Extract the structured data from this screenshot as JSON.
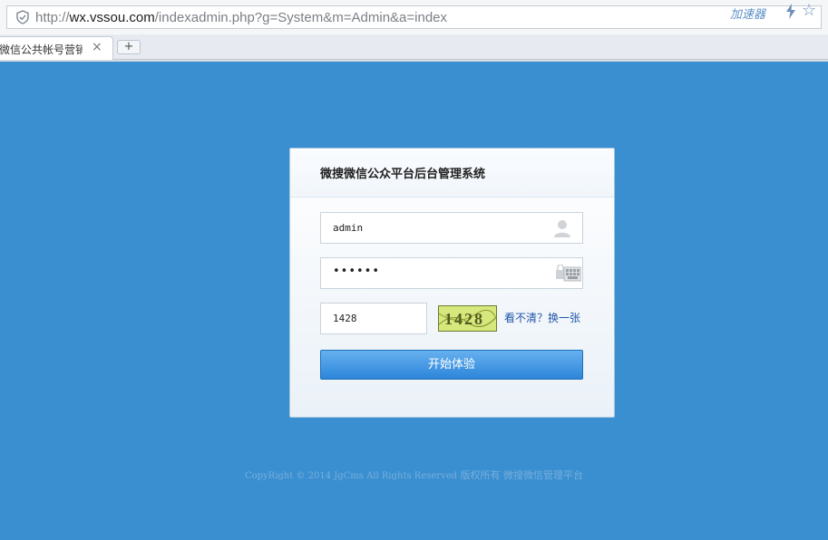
{
  "browser": {
    "url_prefix": "http://",
    "url_host": "wx.vssou.com",
    "url_path": "/indexadmin.php?g=System&m=Admin&a=index",
    "speedup_label": "加速器",
    "tab_title": "微信公共帐号营销平",
    "tab_close": "×",
    "new_tab": "+",
    "star_glyph": "☆"
  },
  "login": {
    "title": "微搜微信公众平台后台管理系统",
    "username_value": "admin",
    "password_dots": "••••••",
    "captcha_value": "1428",
    "captcha_image_text": "1428",
    "refresh_link": "看不清？换一张",
    "submit_label": "开始体验"
  },
  "footer": {
    "copyright": "CopyRight © 2014 JgCms All Rights Reserved",
    "rights": " 版权所有 微搜微信管理平台"
  },
  "colors": {
    "page_bg": "#3a8fd0",
    "button": "#2d86da",
    "link": "#1f56a8"
  }
}
